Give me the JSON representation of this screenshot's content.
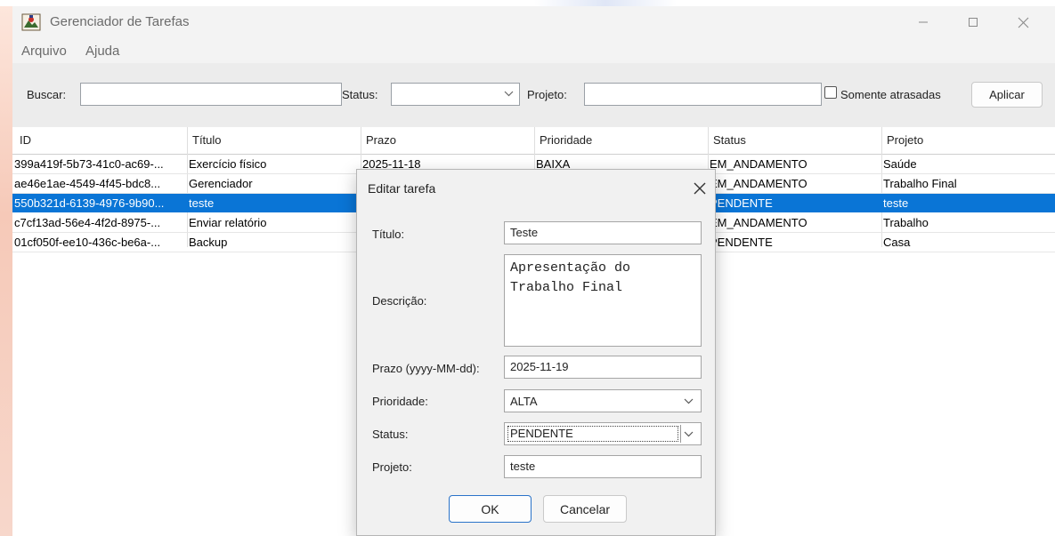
{
  "window": {
    "title": "Gerenciador de Tarefas"
  },
  "menu": {
    "items": [
      "Arquivo",
      "Ajuda"
    ]
  },
  "filters": {
    "search_label": "Buscar:",
    "search_value": "",
    "status_label": "Status:",
    "status_value": "",
    "project_label": "Projeto:",
    "project_value": "",
    "overdue_label": "Somente atrasadas",
    "overdue_checked": false,
    "apply_label": "Aplicar"
  },
  "table": {
    "columns": [
      "ID",
      "Título",
      "Prazo",
      "Prioridade",
      "Status",
      "Projeto"
    ],
    "rows": [
      [
        "399a419f-5b73-41c0-ac69-...",
        "Exercício físico",
        "2025-11-18",
        "BAIXA",
        "EM_ANDAMENTO",
        "Saúde"
      ],
      [
        "ae46e1ae-4549-4f45-bdc8...",
        "Gerenciador",
        "",
        "",
        "EM_ANDAMENTO",
        "Trabalho Final"
      ],
      [
        "550b321d-6139-4976-9b90...",
        "teste",
        "",
        "",
        "PENDENTE",
        "teste"
      ],
      [
        "c7cf13ad-56e4-4f2d-8975-...",
        "Enviar relatório",
        "",
        "",
        "EM_ANDAMENTO",
        "Trabalho"
      ],
      [
        "01cf050f-ee10-436c-be6a-...",
        "Backup",
        "",
        "",
        "PENDENTE",
        "Casa"
      ]
    ],
    "selected_row": 2
  },
  "dialog": {
    "title": "Editar tarefa",
    "title_label": "Título:",
    "title_value": "Teste",
    "description_label": "Descrição:",
    "description_value": "Apresentação do\nTrabalho Final",
    "deadline_label": "Prazo (yyyy-MM-dd):",
    "deadline_value": "2025-11-19",
    "priority_label": "Prioridade:",
    "priority_value": "ALTA",
    "status_label": "Status:",
    "status_value": "PENDENTE",
    "project_label": "Projeto:",
    "project_value": "teste",
    "ok_label": "OK",
    "cancel_label": "Cancelar"
  },
  "colors": {
    "selection": "#0a75d6",
    "window_bg": "#ececec"
  }
}
